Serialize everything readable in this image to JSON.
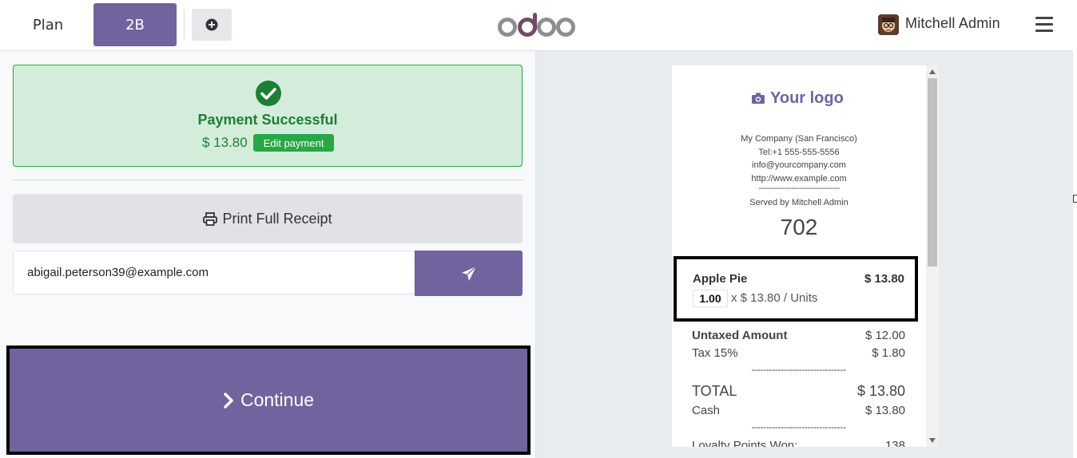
{
  "topbar": {
    "tabs": [
      "Plan",
      "2B"
    ],
    "add_icon": "plus-circle-icon",
    "logo_text": "odoo",
    "user_name": "Mitchell Admin",
    "menu_icon": "hamburger-menu-icon"
  },
  "payment": {
    "status_title": "Payment Successful",
    "amount": "$ 13.80",
    "edit_label": "Edit payment",
    "status_color": "#28a745"
  },
  "actions": {
    "print_label": "Print Full Receipt",
    "email_value": "abigail.peterson39@example.com",
    "send_icon": "paper-plane-icon",
    "continue_label": "Continue",
    "accent_color": "#71639e"
  },
  "receipt": {
    "logo_text": "Your logo",
    "company_lines": [
      "My Company (San Francisco)",
      "Tel:+1 555-555-5556",
      "info@yourcompany.com",
      "http://www.example.com"
    ],
    "separator": "--------------------------------",
    "served_by": "Served by Mitchell Admin",
    "order_number": "702",
    "line": {
      "product": "Apple Pie",
      "price": "$ 13.80",
      "qty": "1.00",
      "unit_price": "x $ 13.80 / Units"
    },
    "untaxed_label": "Untaxed Amount",
    "untaxed_value": "$ 12.00",
    "tax_label": "Tax 15%",
    "tax_value": "$ 1.80",
    "separator_long": "--------------------------------",
    "total_label": "TOTAL",
    "total_value": "$ 13.80",
    "cash_label": "Cash",
    "cash_value": "$ 13.80",
    "loyalty_label": "Loyalty Points Won:",
    "loyalty_value": "138"
  }
}
